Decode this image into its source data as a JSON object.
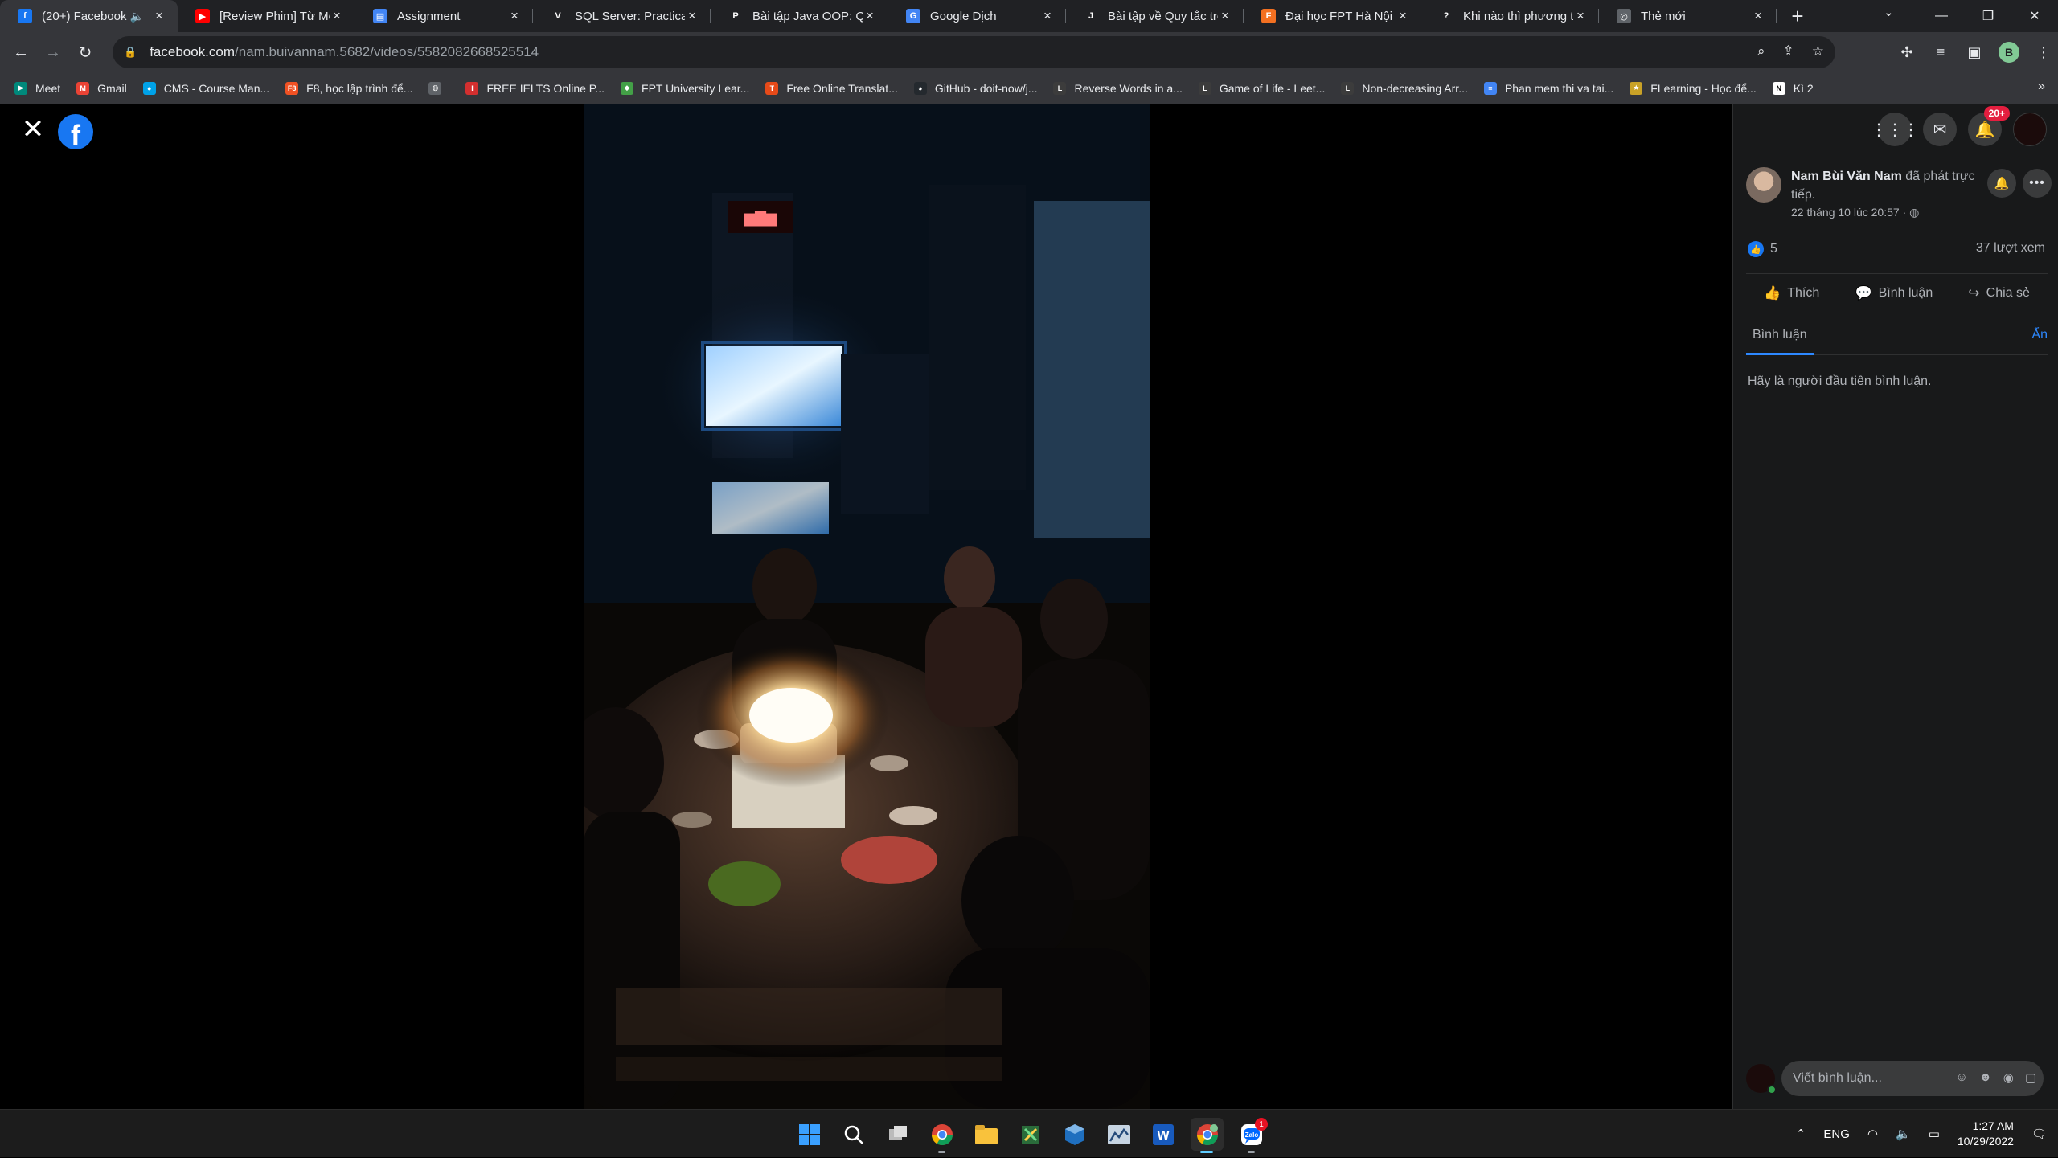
{
  "browser": {
    "tabs": [
      {
        "title": "(20+) Facebook",
        "icon": "facebook-icon",
        "color": "#1877f2",
        "glyph": "f",
        "active": true,
        "muted": true
      },
      {
        "title": "[Review Phim] Từ Mộ",
        "icon": "youtube-icon",
        "color": "#ff0000",
        "glyph": "▶"
      },
      {
        "title": "Assignment",
        "icon": "assignment-icon",
        "color": "#4285f4",
        "glyph": "▤"
      },
      {
        "title": "SQL Server: Practical",
        "icon": "v1-icon",
        "color": "#202124",
        "glyph": "V"
      },
      {
        "title": "Bài tập Java OOP: Qu",
        "icon": "pinterest-icon",
        "color": "#202124",
        "glyph": "P"
      },
      {
        "title": "Google Dịch",
        "icon": "translate-icon",
        "color": "#4285f4",
        "glyph": "G"
      },
      {
        "title": "Bài tập về Quy tắc trợ",
        "icon": "java-icon",
        "color": "#202124",
        "glyph": "J"
      },
      {
        "title": "Đại học FPT Hà Nội b",
        "icon": "fpt-icon",
        "color": "#f37021",
        "glyph": "F"
      },
      {
        "title": "Khi nào thì phương t",
        "icon": "khan-icon",
        "color": "#202124",
        "glyph": "?"
      },
      {
        "title": "Thẻ mới",
        "icon": "chrome-icon",
        "color": "#5f6368",
        "glyph": "◎"
      }
    ],
    "address": {
      "host": "facebook.com",
      "path": "/nam.buivannam.5682/videos/5582082668525514"
    },
    "profile_initial": "B",
    "bookmarks": [
      {
        "label": "Meet",
        "icon": "meet-icon",
        "color": "#00897b",
        "glyph": "▶"
      },
      {
        "label": "Gmail",
        "icon": "gmail-icon",
        "color": "#ea4335",
        "glyph": "M"
      },
      {
        "label": "CMS - Course Man...",
        "icon": "cms-icon",
        "color": "#00a2e8",
        "glyph": "●"
      },
      {
        "label": "F8, học lập trình để...",
        "icon": "f8-icon",
        "color": "#f05123",
        "glyph": "F8"
      },
      {
        "label": "",
        "icon": "globe-icon",
        "color": "#5f6368",
        "glyph": "◍"
      },
      {
        "label": "FREE IELTS Online P...",
        "icon": "ielts-icon",
        "color": "#d32f2f",
        "glyph": "I"
      },
      {
        "label": "FPT University Lear...",
        "icon": "fpt-learn-icon",
        "color": "#43a047",
        "glyph": "◆"
      },
      {
        "label": "Free Online Translat...",
        "icon": "translate-doc-icon",
        "color": "#e64a19",
        "glyph": "T"
      },
      {
        "label": "GitHub - doit-now/j...",
        "icon": "github-icon",
        "color": "#24292e",
        "glyph": "◕"
      },
      {
        "label": "Reverse Words in a...",
        "icon": "leetcode-icon",
        "color": "#3c3c3c",
        "glyph": "L"
      },
      {
        "label": "Game of Life - Leet...",
        "icon": "leetcode-icon",
        "color": "#3c3c3c",
        "glyph": "L"
      },
      {
        "label": "Non-decreasing Arr...",
        "icon": "leetcode-icon",
        "color": "#3c3c3c",
        "glyph": "L"
      },
      {
        "label": "Phan mem thi va tai...",
        "icon": "docs-icon",
        "color": "#4285f4",
        "glyph": "≡"
      },
      {
        "label": "FLearning - Học để...",
        "icon": "flearning-icon",
        "color": "#c9a227",
        "glyph": "★"
      },
      {
        "label": "Kì 2",
        "icon": "notion-icon",
        "color": "#ffffff",
        "glyph": "N"
      }
    ]
  },
  "viewer": {
    "poster_name": "Nam Bùi Văn Nam",
    "poster_action": "đã phát trực tiếp.",
    "post_time": "22 tháng 10 lúc 20:57 ·",
    "like_count": "5",
    "view_count": "37 lượt xem",
    "actions": {
      "like": "Thích",
      "comment": "Bình luận",
      "share": "Chia sẻ"
    },
    "comments_tab": "Bình luận",
    "hide_label": "Ẩn",
    "empty_text": "Hãy là người đầu tiên bình luận.",
    "composer_placeholder": "Viết bình luận...",
    "notification_badge": "20+"
  },
  "taskbar": {
    "apps": [
      {
        "icon": "windows-start-icon"
      },
      {
        "icon": "search-icon"
      },
      {
        "icon": "task-view-icon"
      },
      {
        "icon": "chrome-icon",
        "running": true
      },
      {
        "icon": "file-explorer-icon"
      },
      {
        "icon": "snipping-tool-icon"
      },
      {
        "icon": "virtualbox-icon"
      },
      {
        "icon": "sql-server-icon"
      },
      {
        "icon": "word-icon"
      },
      {
        "icon": "chrome-profile-icon",
        "running": true,
        "active": true
      },
      {
        "icon": "zalo-icon",
        "running": true,
        "badge": "1"
      }
    ],
    "language": "ENG",
    "time": "1:27 AM",
    "date": "10/29/2022"
  }
}
